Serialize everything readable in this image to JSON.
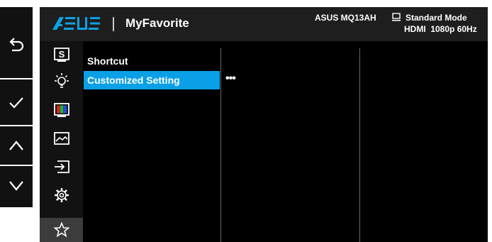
{
  "header": {
    "brand": "ASUS",
    "title": "MyFavorite",
    "model": "ASUS MQ13AH",
    "mode": "Standard Mode",
    "signal": "HDMI  1080p 60Hz"
  },
  "keys": [
    {
      "icon": "return-icon"
    },
    {
      "icon": "checkmark-icon"
    },
    {
      "icon": "chevron-up-icon"
    },
    {
      "icon": "chevron-down-icon"
    }
  ],
  "sidebar": {
    "items": [
      {
        "icon": "splendid-s-icon"
      },
      {
        "icon": "brightness-bulb-icon"
      },
      {
        "icon": "color-bars-icon"
      },
      {
        "icon": "image-icon"
      },
      {
        "icon": "input-select-icon"
      },
      {
        "icon": "system-setup-gear-icon"
      },
      {
        "icon": "myfavorite-star-icon",
        "active": true
      }
    ]
  },
  "menu": {
    "items": [
      {
        "label": "Shortcut"
      },
      {
        "label": "Customized Setting",
        "selected": true
      }
    ],
    "submenu_hint": "•••"
  },
  "colors": {
    "highlight": "#0a9fe6",
    "panel": "#000000",
    "header": "#1e1e1e",
    "keys": "#111111"
  }
}
